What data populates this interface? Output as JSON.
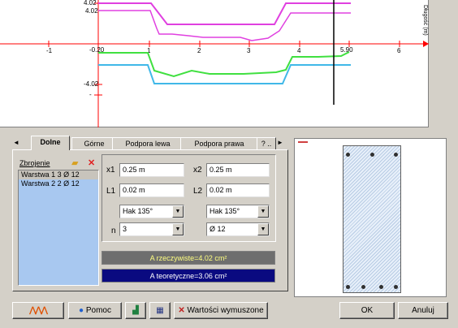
{
  "chart": {
    "x_ticks": [
      "-1",
      "-0.20",
      "1",
      "2",
      "3",
      "4",
      "5.90",
      "6"
    ],
    "y_ticks": [
      "4.02",
      "4.02",
      "-4.02"
    ],
    "y_axis_label": "Długość (m)"
  },
  "tabs": [
    "Dolne",
    "Górne",
    "Podpora lewa",
    "Podpora prawa",
    "? .."
  ],
  "active_tab": "Dolne",
  "list": {
    "header": "Zbrojenie",
    "items": [
      "Warstwa 1 3 Ø 12",
      "Warstwa 2 2 Ø 12"
    ]
  },
  "fields": {
    "x1_label": "x1",
    "x1_value": "0.25 m",
    "x2_label": "x2",
    "x2_value": "0.25 m",
    "l1_label": "L1",
    "l1_value": "0.02 m",
    "l2_label": "L2",
    "l2_value": "0.02 m",
    "hook_left": "Hak 135°",
    "hook_right": "Hak 135°",
    "n_label": "n",
    "n_value": "3",
    "diameter": "Ø 12"
  },
  "areas": {
    "actual": "A rzeczywiste=4.02 cm²",
    "theoretical": "A teoretyczne=3.06 cm²",
    "actual_bg": "#6e6e6e",
    "actual_fg": "#ffff80",
    "theoretical_bg": "#0a0a80",
    "theoretical_fg": "#ffffff"
  },
  "buttons": {
    "help": "Pomoc",
    "required_values": "Wartości wymuszone",
    "ok": "OK",
    "cancel": "Anuluj"
  }
}
